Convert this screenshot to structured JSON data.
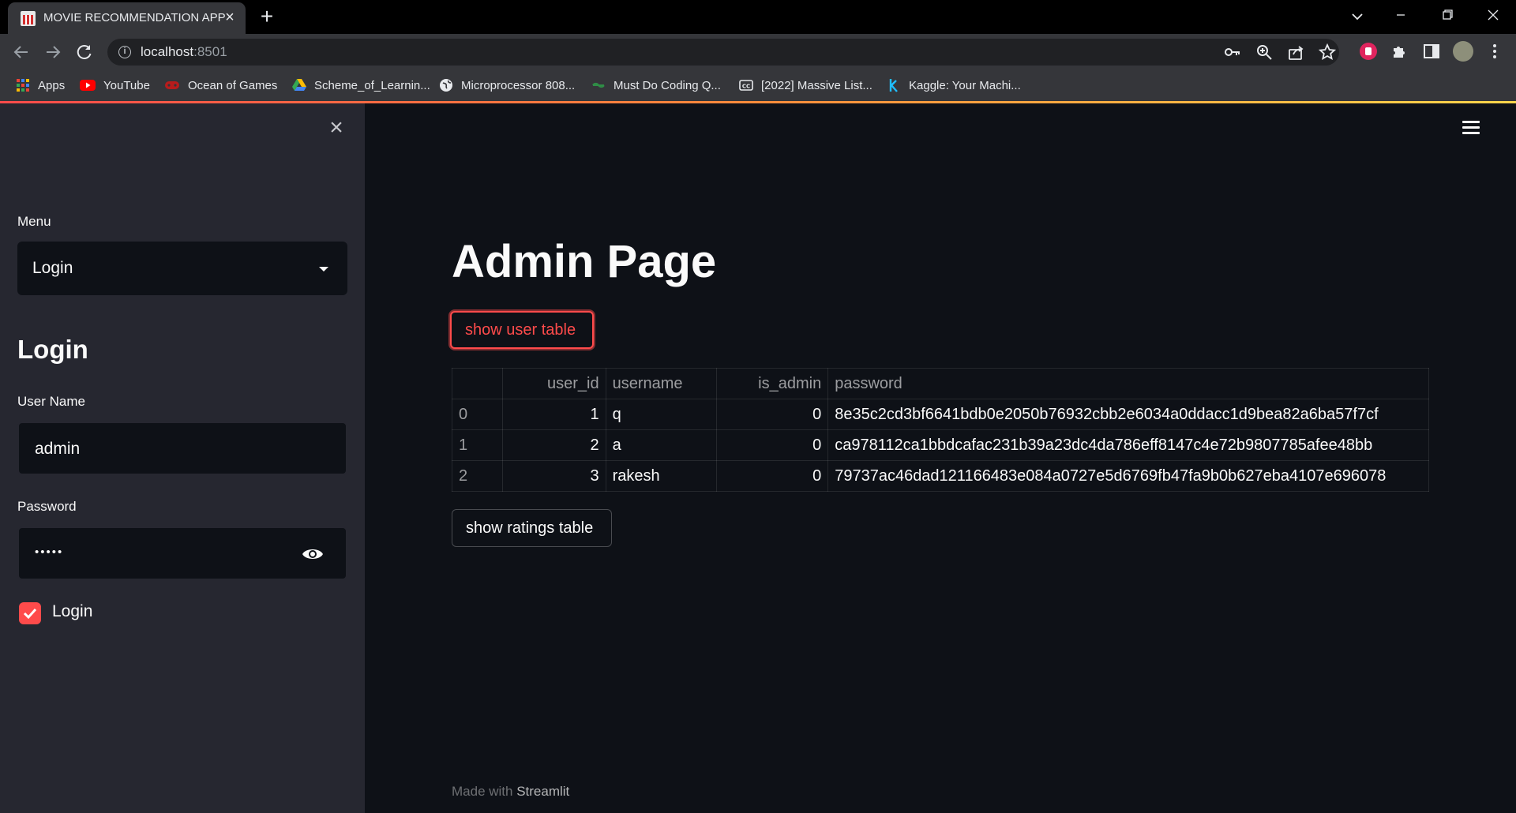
{
  "browser": {
    "tab_title": "MOVIE RECOMMENDATION APP",
    "url_host": "localhost",
    "url_port": ":8501",
    "bookmarks": [
      {
        "label": "Apps",
        "icon": "apps-grid-icon"
      },
      {
        "label": "YouTube",
        "icon": "youtube-icon"
      },
      {
        "label": "Ocean of Games",
        "icon": "gamepad-icon"
      },
      {
        "label": "Scheme_of_Learnin...",
        "icon": "google-drive-icon"
      },
      {
        "label": "Microprocessor 808...",
        "icon": "globe-icon"
      },
      {
        "label": "Must Do Coding Q...",
        "icon": "geeksforgeeks-icon"
      },
      {
        "label": "[2022] Massive List...",
        "icon": "cc-icon"
      },
      {
        "label": "Kaggle: Your Machi...",
        "icon": "kaggle-icon"
      }
    ]
  },
  "sidebar": {
    "menu_label": "Menu",
    "menu_value": "Login",
    "heading": "Login",
    "username_label": "User Name",
    "username_value": "admin",
    "password_label": "Password",
    "password_mask": "•••••",
    "checkbox_label": "Login",
    "checkbox_checked": true
  },
  "main": {
    "title": "Admin Page",
    "show_user_table_label": "show user table",
    "show_ratings_table_label": "show ratings table",
    "footer_prefix": "Made with ",
    "footer_brand": "Streamlit"
  },
  "user_table": {
    "columns": [
      "",
      "user_id",
      "username",
      "is_admin",
      "password"
    ],
    "rows": [
      [
        "0",
        "1",
        "q",
        "0",
        "8e35c2cd3bf6641bdb0e2050b76932cbb2e6034a0ddacc1d9bea82a6ba57f7cf"
      ],
      [
        "1",
        "2",
        "a",
        "0",
        "ca978112ca1bbdcafac231b39a23dc4da786eff8147c4e72b9807785afee48bb"
      ],
      [
        "2",
        "3",
        "rakesh",
        "0",
        "79737ac46dad121166483e084a0727e5d6769fb47fa9b0b627eba4107e696078"
      ]
    ]
  },
  "colors": {
    "accent": "#ff4b4b",
    "background": "#0e1117",
    "sidebar_background": "#262730"
  }
}
